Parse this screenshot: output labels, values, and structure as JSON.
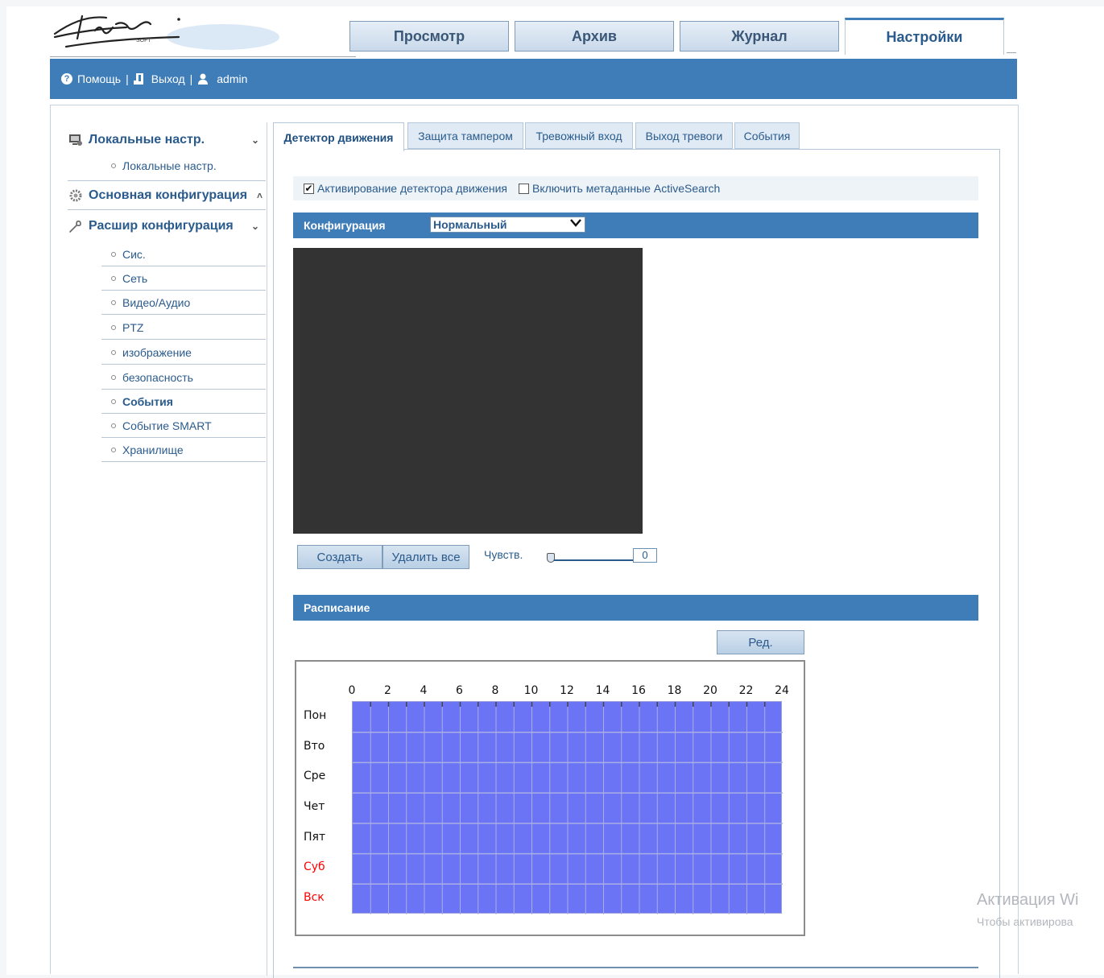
{
  "header": {
    "logo_text": "Stic SOFT",
    "tabs": [
      {
        "label": "Просмотр"
      },
      {
        "label": "Архив"
      },
      {
        "label": "Журнал"
      },
      {
        "label": "Настройки",
        "active": true
      }
    ]
  },
  "topbar": {
    "help": "Помощь",
    "logout": "Выход",
    "user": "admin",
    "separator": "|"
  },
  "sidebar": {
    "groups": [
      {
        "label": "Локальные настр.",
        "icon": "local-settings-icon",
        "expanded": true,
        "items": [
          "Локальные настр."
        ]
      },
      {
        "label": "Основная конфигурация",
        "icon": "gear-icon",
        "expanded": false
      },
      {
        "label": "Расшир конфигурация",
        "icon": "wrench-icon",
        "expanded": true,
        "items": [
          "Сис.",
          "Сеть",
          "Видео/Аудио",
          "PTZ",
          "изображение",
          "безопасность",
          "События",
          "Событие SMART",
          "Хранилище"
        ],
        "selected": "События"
      }
    ]
  },
  "subtabs": [
    "Детектор движения",
    "Защита тампером",
    "Тревожный вход",
    "Выход тревоги",
    "События"
  ],
  "motion": {
    "enable_label": "Активирование детектора движения",
    "enable_checked": true,
    "metadata_label": "Включить метаданные ActiveSearch",
    "metadata_checked": false,
    "config_label": "Конфигурация",
    "config_value": "Нормальный",
    "create_btn": "Создать",
    "delete_all_btn": "Удалить все",
    "sensitivity_label": "Чувств.",
    "sensitivity_value": "0"
  },
  "schedule": {
    "title": "Расписание",
    "edit_btn": "Ред.",
    "hours": [
      "0",
      "2",
      "4",
      "6",
      "8",
      "10",
      "12",
      "14",
      "16",
      "18",
      "20",
      "22",
      "24"
    ],
    "days": [
      {
        "label": "Пон",
        "weekend": false
      },
      {
        "label": "Вто",
        "weekend": false
      },
      {
        "label": "Сре",
        "weekend": false
      },
      {
        "label": "Чет",
        "weekend": false
      },
      {
        "label": "Пят",
        "weekend": false
      },
      {
        "label": "Суб",
        "weekend": true
      },
      {
        "label": "Вск",
        "weekend": true
      }
    ],
    "fill_color": "#6a74f4",
    "coverage": "all days 0-24"
  },
  "watermark": {
    "line1": "Активация Wi",
    "line2": "Чтобы активирова"
  },
  "colors": {
    "accent": "#3f7db8",
    "text": "#2a5b8c",
    "weekend": "#ff0000"
  }
}
